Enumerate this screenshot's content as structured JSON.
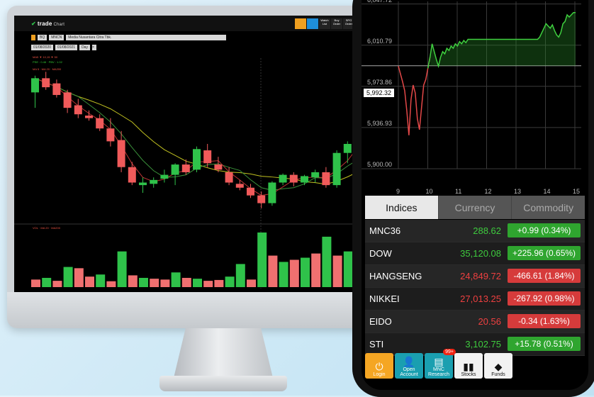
{
  "desktop": {
    "logo": "trade",
    "logo_sub": "Chart",
    "toolbar_buttons": [
      {
        "label": "",
        "color": "#f0a020"
      },
      {
        "label": "",
        "color": "#1e8ed9"
      },
      {
        "label": "Watch List",
        "color": "#222"
      },
      {
        "label": "Buy Order",
        "color": "#222"
      },
      {
        "label": "SPO Order",
        "color": "#222"
      },
      {
        "label": "Sell",
        "color": "#222"
      }
    ],
    "stock_code": "MNCN",
    "stock_name": "Media Nusantara Citra Tbk.",
    "chip_small": "BQ",
    "date_from": "01/08/2020",
    "date_to": "01/08/2021",
    "period": "Day",
    "indicator_1": "MA5 ▼ 10,15 ▼ 50",
    "indicator_2": "PSE : 0.46 · PBV : 1.02",
    "indicator_3": "MA 5 · MA 20 · MA200",
    "volume_indicator": "VOL · MA 20 · MA200",
    "candles": [
      {
        "o": 170,
        "h": 183,
        "l": 158,
        "c": 181
      },
      {
        "o": 181,
        "h": 186,
        "l": 172,
        "c": 174
      },
      {
        "o": 177,
        "h": 180,
        "l": 166,
        "c": 168
      },
      {
        "o": 170,
        "h": 172,
        "l": 154,
        "c": 158
      },
      {
        "o": 160,
        "h": 165,
        "l": 150,
        "c": 153
      },
      {
        "o": 152,
        "h": 156,
        "l": 148,
        "c": 150
      },
      {
        "o": 150,
        "h": 153,
        "l": 140,
        "c": 142
      },
      {
        "o": 142,
        "h": 150,
        "l": 128,
        "c": 132
      },
      {
        "o": 133,
        "h": 140,
        "l": 108,
        "c": 112
      },
      {
        "o": 112,
        "h": 116,
        "l": 98,
        "c": 100
      },
      {
        "o": 98,
        "h": 104,
        "l": 92,
        "c": 100
      },
      {
        "o": 99,
        "h": 104,
        "l": 96,
        "c": 102
      },
      {
        "o": 103,
        "h": 110,
        "l": 100,
        "c": 106
      },
      {
        "o": 106,
        "h": 115,
        "l": 98,
        "c": 114
      },
      {
        "o": 114,
        "h": 118,
        "l": 106,
        "c": 108
      },
      {
        "o": 110,
        "h": 128,
        "l": 108,
        "c": 126
      },
      {
        "o": 125,
        "h": 130,
        "l": 112,
        "c": 115
      },
      {
        "o": 114,
        "h": 120,
        "l": 108,
        "c": 110
      },
      {
        "o": 108,
        "h": 112,
        "l": 98,
        "c": 100
      },
      {
        "o": 99,
        "h": 102,
        "l": 94,
        "c": 96
      },
      {
        "o": 96,
        "h": 99,
        "l": 88,
        "c": 90
      },
      {
        "o": 90,
        "h": 93,
        "l": 80,
        "c": 84
      },
      {
        "o": 84,
        "h": 101,
        "l": 82,
        "c": 100
      },
      {
        "o": 100,
        "h": 107,
        "l": 98,
        "c": 106
      },
      {
        "o": 106,
        "h": 108,
        "l": 97,
        "c": 100
      },
      {
        "o": 100,
        "h": 106,
        "l": 98,
        "c": 105
      },
      {
        "o": 104,
        "h": 110,
        "l": 100,
        "c": 108
      },
      {
        "o": 108,
        "h": 112,
        "l": 96,
        "c": 98
      },
      {
        "o": 98,
        "h": 125,
        "l": 96,
        "c": 123
      },
      {
        "o": 123,
        "h": 132,
        "l": 115,
        "c": 130
      },
      {
        "o": 124,
        "h": 133,
        "l": 112,
        "c": 131
      }
    ],
    "volumes": [
      {
        "v": 18,
        "up": false
      },
      {
        "v": 22,
        "up": true
      },
      {
        "v": 15,
        "up": false
      },
      {
        "v": 48,
        "up": true
      },
      {
        "v": 45,
        "up": false
      },
      {
        "v": 25,
        "up": false
      },
      {
        "v": 30,
        "up": true
      },
      {
        "v": 14,
        "up": false
      },
      {
        "v": 85,
        "up": true
      },
      {
        "v": 28,
        "up": false
      },
      {
        "v": 22,
        "up": true
      },
      {
        "v": 20,
        "up": false
      },
      {
        "v": 18,
        "up": false
      },
      {
        "v": 35,
        "up": true
      },
      {
        "v": 22,
        "up": false
      },
      {
        "v": 20,
        "up": true
      },
      {
        "v": 15,
        "up": false
      },
      {
        "v": 17,
        "up": false
      },
      {
        "v": 25,
        "up": true
      },
      {
        "v": 55,
        "up": true
      },
      {
        "v": 18,
        "up": false
      },
      {
        "v": 130,
        "up": true
      },
      {
        "v": 75,
        "up": false
      },
      {
        "v": 60,
        "up": true
      },
      {
        "v": 65,
        "up": false
      },
      {
        "v": 70,
        "up": true
      },
      {
        "v": 80,
        "up": false
      },
      {
        "v": 120,
        "up": true
      },
      {
        "v": 75,
        "up": false
      },
      {
        "v": 85,
        "up": true
      },
      {
        "v": 78,
        "up": false
      }
    ]
  },
  "phone": {
    "y_labels": [
      "6,047.72",
      "6,010.79",
      "5,973.86",
      "5,936.93",
      "5,900.00"
    ],
    "x_labels": [
      "9",
      "10",
      "11",
      "12",
      "13",
      "14",
      "15"
    ],
    "current_price": "5,992.32",
    "intraday": [
      5992,
      5985,
      5978,
      5970,
      5952,
      5930,
      5962,
      5975,
      5968,
      5945,
      5935,
      5955,
      5975,
      5980,
      5990,
      6000,
      6012,
      6005,
      5998,
      5992,
      6000,
      6005,
      6003,
      6008,
      6006,
      6010,
      6008,
      6012,
      6010,
      6014,
      6012,
      6015,
      6013,
      6016,
      6016,
      6016,
      6016,
      6016,
      6016,
      6016,
      6016,
      6016,
      6016,
      6016,
      6016,
      6016,
      6016,
      6016,
      6016,
      6016,
      6016,
      6016,
      6016,
      6016,
      6016,
      6016,
      6016,
      6016,
      6016,
      6016,
      6016,
      6016,
      6016,
      6016,
      6016,
      6016,
      6016,
      6018,
      6022,
      6026,
      6030,
      6028,
      6026,
      6029,
      6024,
      6020,
      6018,
      6022,
      6030,
      6032,
      6038,
      6036,
      6038,
      6040,
      6040
    ],
    "tabs": [
      "Indices",
      "Currency",
      "Commodity"
    ],
    "active_tab": 0,
    "indices": [
      {
        "name": "MNC36",
        "value": "288.62",
        "change": "+0.99 (0.34%)",
        "up": true
      },
      {
        "name": "DOW",
        "value": "35,120.08",
        "change": "+225.96 (0.65%)",
        "up": true
      },
      {
        "name": "HANGSENG",
        "value": "24,849.72",
        "change": "-466.61 (1.84%)",
        "up": false
      },
      {
        "name": "NIKKEI",
        "value": "27,013.25",
        "change": "-267.92 (0.98%)",
        "up": false
      },
      {
        "name": "EIDO",
        "value": "20.56",
        "change": "-0.34 (1.63%)",
        "up": false
      },
      {
        "name": "STI",
        "value": "3,102.75",
        "change": "+15.78 (0.51%)",
        "up": true
      }
    ],
    "dock": [
      {
        "label": "Login",
        "icon": "power-icon",
        "bg": "#f5a623",
        "fg": "#fff"
      },
      {
        "label": "Open Account",
        "icon": "user-icon",
        "bg": "#1a9fb0",
        "fg": "#fff"
      },
      {
        "label": "MNC Research",
        "icon": "research-icon",
        "bg": "#1a9fb0",
        "fg": "#fff",
        "badge": "99+"
      },
      {
        "label": "Stocks",
        "icon": "bar-chart-icon",
        "bg": "#f2f2f2",
        "fg": "#111"
      },
      {
        "label": "Funds",
        "icon": "funds-icon",
        "bg": "#f2f2f2",
        "fg": "#111"
      }
    ]
  }
}
